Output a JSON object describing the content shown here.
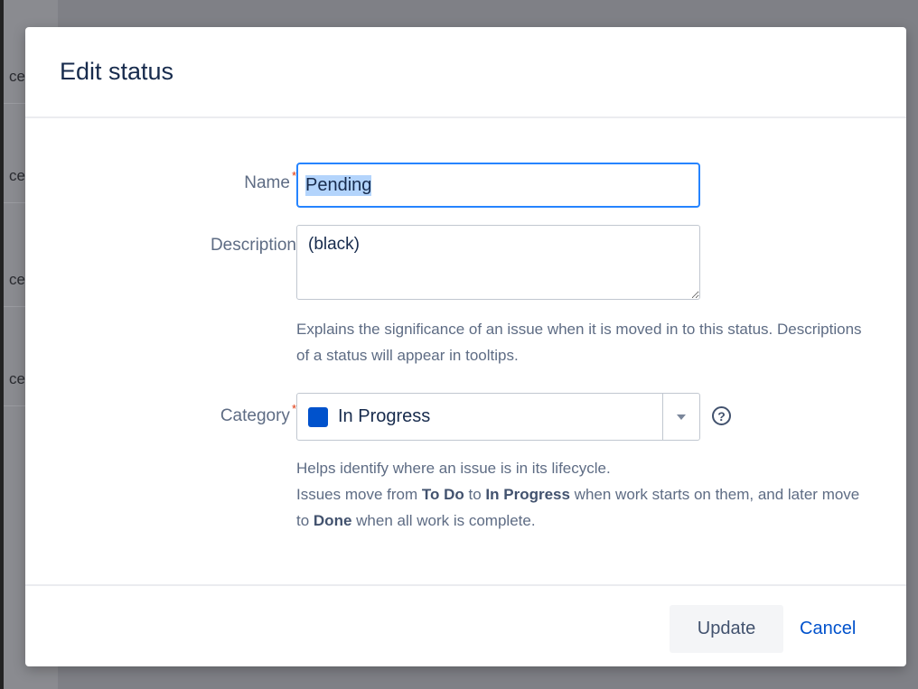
{
  "background": {
    "row_fragments": [
      "ce",
      "ce",
      "ce",
      "ce"
    ]
  },
  "dialog": {
    "title": "Edit status",
    "fields": {
      "name": {
        "label": "Name",
        "required_marker": "*",
        "value": "Pending"
      },
      "description": {
        "label": "Description",
        "value": "(black)",
        "help": "Explains the significance of an issue when it is moved in to this status. Descriptions of a status will appear in tooltips."
      },
      "category": {
        "label": "Category",
        "required_marker": "*",
        "value": "In Progress",
        "swatch_color": "#0052cc",
        "help_icon_glyph": "?",
        "help": {
          "line1": "Helps identify where an issue is in its lifecycle.",
          "p1": "Issues move from ",
          "b1": "To Do",
          "p2": " to ",
          "b2": "In Progress",
          "p3": " when work starts on them, and later move to ",
          "b3": "Done",
          "p4": " when all work is complete."
        }
      }
    },
    "footer": {
      "update_label": "Update",
      "cancel_label": "Cancel"
    }
  },
  "colors": {
    "accent": "#2684ff",
    "link": "#0052cc",
    "required": "#de350b"
  }
}
